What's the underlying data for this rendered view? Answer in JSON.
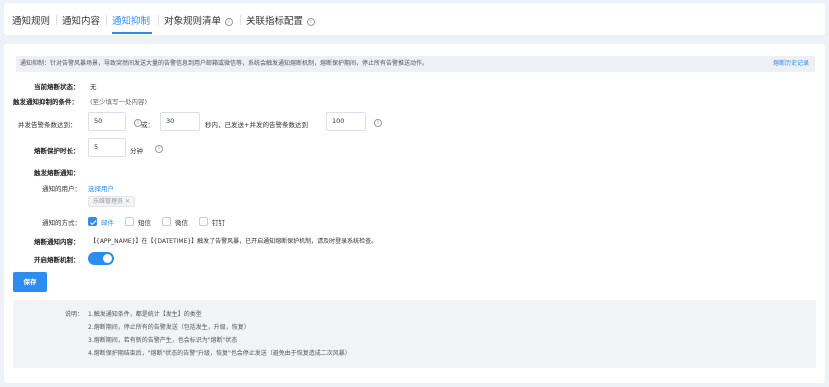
{
  "tabs": [
    {
      "label": "通知规则"
    },
    {
      "label": "通知内容"
    },
    {
      "label": "通知抑制"
    },
    {
      "label": "对象规则清单"
    },
    {
      "label": "关联指标配置"
    }
  ],
  "alert": {
    "text": "通知抑制：针对告警风暴场景，导致突然间发送大量的告警信息到用户邮箱或微信等，系统会触发通知熔断机制，熔断保护期间，停止所有告警推送动作。",
    "link": "熔断历史记录"
  },
  "status": {
    "label": "当前熔断状态：",
    "value": "无"
  },
  "condition": {
    "label": "触发通知抑制的条件：",
    "hint": "(至少填写一处内容)"
  },
  "counts": {
    "label": "并发告警条数达到：",
    "value1": "50",
    "or": "或：",
    "value2": "30",
    "mid_text": "秒内，已发送+并发的告警条数达到",
    "value3": "100"
  },
  "duration": {
    "label": "熔断保护时长：",
    "value": "5",
    "unit": "分钟"
  },
  "notify": {
    "heading": "触发熔断通知：",
    "user_label": "通知的用户：",
    "select_link": "选择用户",
    "user_tag": "乐维管理员",
    "method_label": "通知的方式：",
    "methods": [
      {
        "label": "邮件",
        "checked": true
      },
      {
        "label": "短信",
        "checked": false
      },
      {
        "label": "微信",
        "checked": false
      },
      {
        "label": "钉钉",
        "checked": false
      }
    ],
    "content_label": "熔断通知内容：",
    "content": "【{APP_NAME}】在【{DATETIME}】触发了告警风暴，已开启通知熔断保护机制，请及时登录系统检查。"
  },
  "switch": {
    "label": "开启熔断机制：",
    "on": true
  },
  "save_label": "保存",
  "notes": {
    "title": "说明：",
    "lines": [
      "1.触发通知条件，都是统计【发生】的类型",
      "2.熔断期间，停止所有的告警发送（包括发生，升级，恢复）",
      "3.熔断期间，若有新的告警产生，也会标识为\"熔断\"状态",
      "4.熔断保护期结束后，\"熔断\"状态的告警\"升级，恢复\"也会停止发送（避免由于恢复造成二次风暴）"
    ]
  },
  "colors": {
    "accent": "#2d8cf0",
    "page_bg": "#eef1f6"
  }
}
